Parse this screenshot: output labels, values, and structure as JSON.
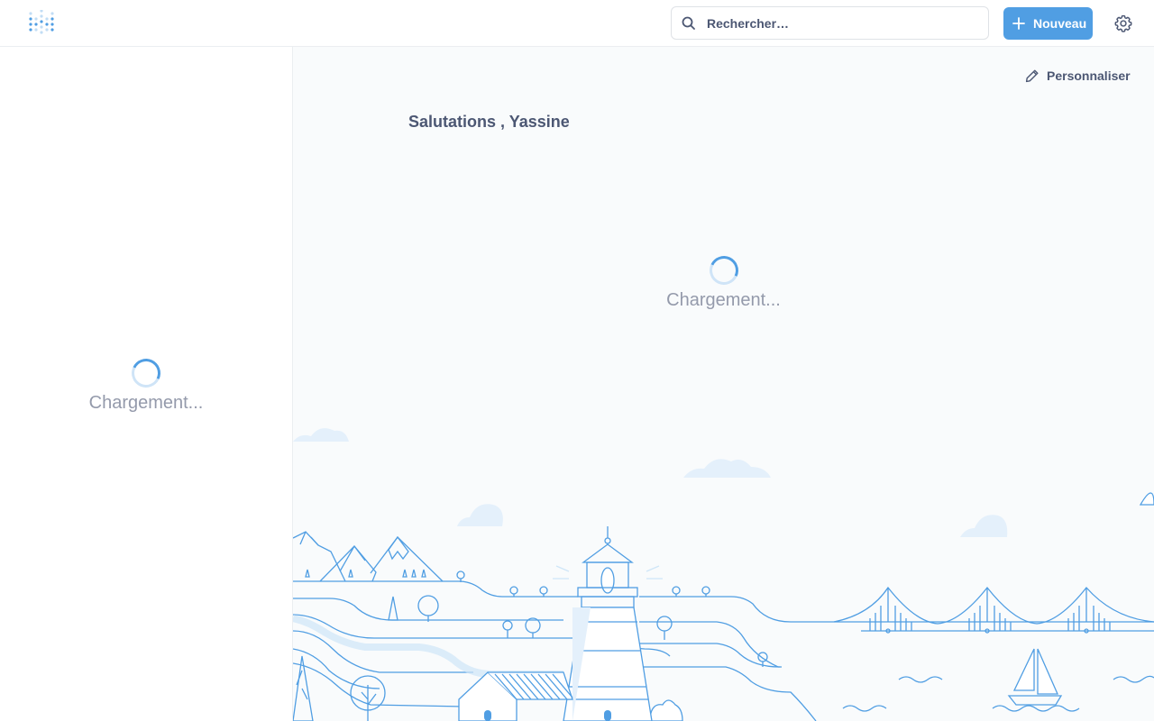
{
  "app": {
    "logo_icon": "metabase-logo-icon"
  },
  "search": {
    "placeholder": "Rechercher…",
    "icon": "search-icon"
  },
  "header": {
    "new_label": "Nouveau",
    "new_icon": "plus-icon",
    "settings_icon": "gear-icon"
  },
  "sidebar": {
    "loading_text": "Chargement..."
  },
  "main": {
    "customize_label": "Personnaliser",
    "customize_icon": "pencil-icon",
    "greeting": "Salutations , Yassine",
    "loading_text": "Chargement..."
  },
  "colors": {
    "brand": "#509ee3",
    "text": "#4c5773",
    "muted": "#949aab",
    "background": "#f9fbfc"
  }
}
